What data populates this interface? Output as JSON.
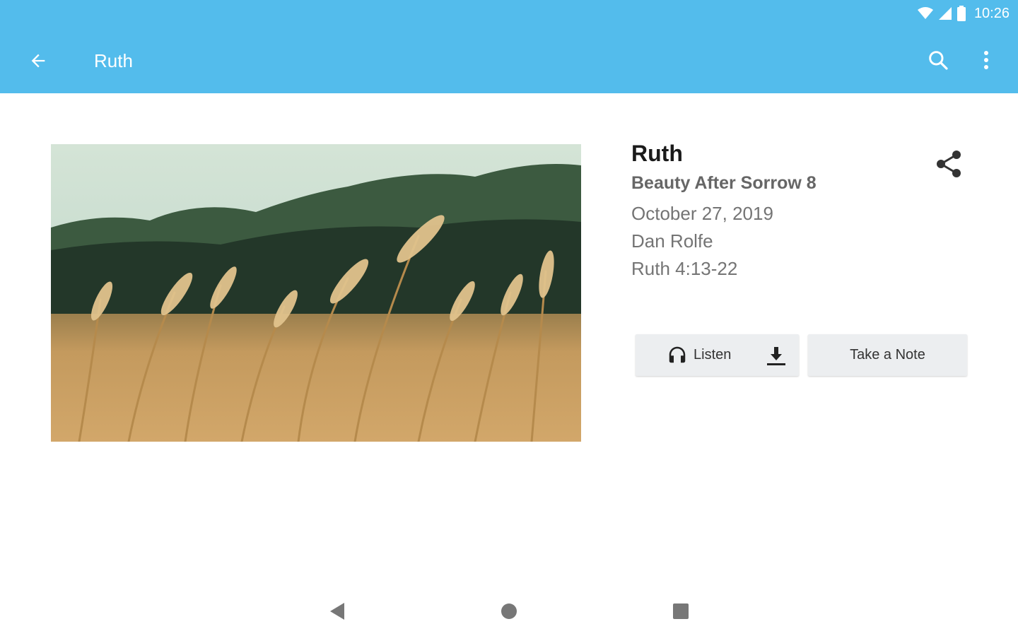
{
  "status_bar": {
    "time": "10:26",
    "icons": [
      "wifi-icon",
      "cell-signal-icon",
      "battery-icon"
    ]
  },
  "toolbar": {
    "title": "Ruth",
    "back_icon": "arrow-back-icon",
    "search_icon": "search-icon",
    "more_icon": "more-vertical-icon",
    "background_color": "#53bcec"
  },
  "sermon": {
    "series": "Ruth",
    "title": "Beauty After Sorrow 8",
    "date": "October 27, 2019",
    "speaker": "Dan Rolfe",
    "passage": "Ruth 4:13-22",
    "share_icon": "share-icon"
  },
  "actions": {
    "listen_label": "Listen",
    "listen_icon": "headphones-icon",
    "download_icon": "download-icon",
    "note_label": "Take a Note"
  },
  "navigation_bar": {
    "icons": [
      "nav-back-icon",
      "nav-home-icon",
      "nav-recents-icon"
    ]
  }
}
